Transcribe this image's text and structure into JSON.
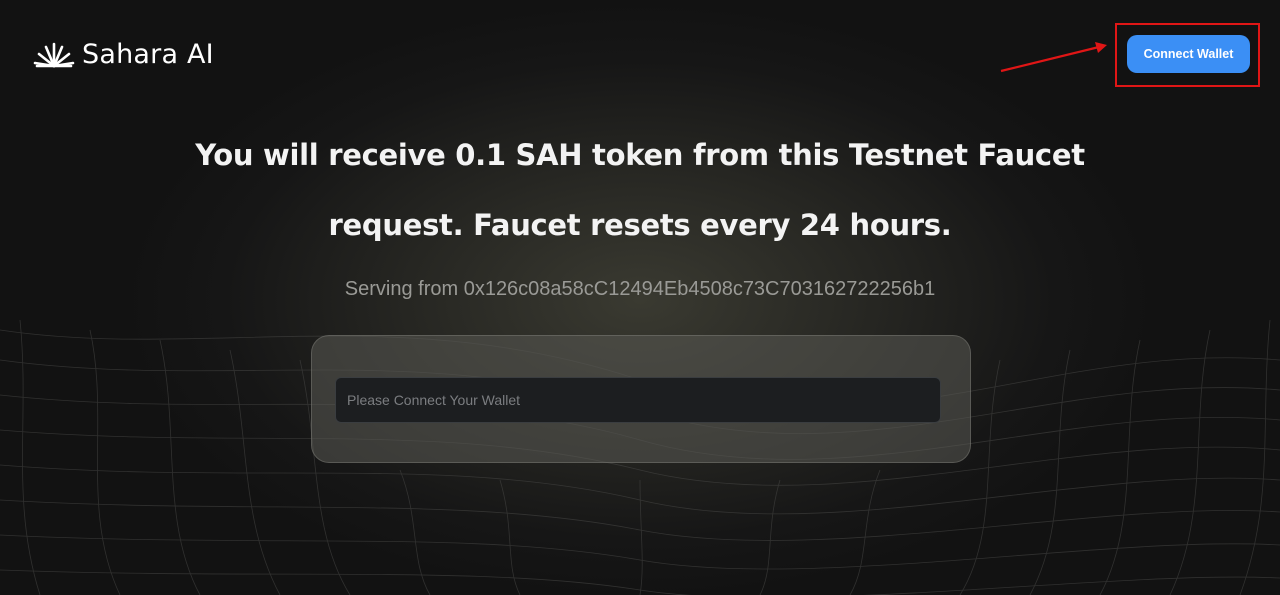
{
  "header": {
    "brand": "Sahara AI",
    "logo_icon": "sunburst-icon",
    "connect_label": "Connect Wallet"
  },
  "main": {
    "headline_line1": "You will receive 0.1 SAH token from this Testnet Faucet",
    "headline_line2": "request. Faucet resets every 24 hours.",
    "serving_text": "Serving from 0x126c08a58cC12494Eb4508c73C703162722256b1",
    "wallet_input": {
      "value": "",
      "placeholder": "Please Connect Your Wallet"
    }
  },
  "annotation": {
    "arrow_icon": "red-arrow-icon",
    "color": "#e01616"
  },
  "colors": {
    "accent": "#3b8ff5",
    "background": "#121212"
  }
}
